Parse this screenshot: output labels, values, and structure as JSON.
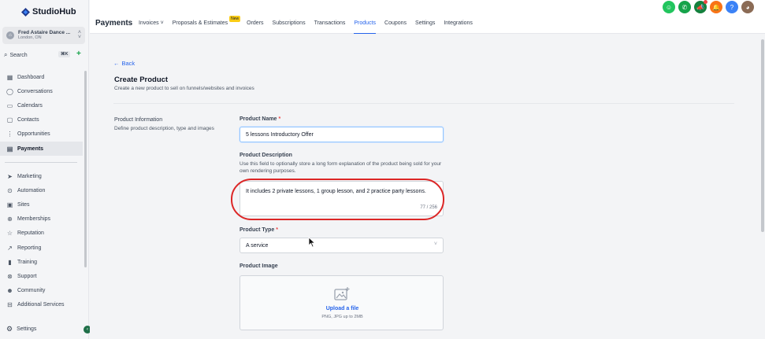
{
  "app": {
    "logo": "StudioHub",
    "account": {
      "name": "Fred Astaire Dance ...",
      "location": "London, ON"
    },
    "search": {
      "label": "Search",
      "shortcut": "⌘K"
    }
  },
  "sidebar": {
    "items": [
      {
        "label": "Dashboard",
        "icon": "dashboard-icon"
      },
      {
        "label": "Conversations",
        "icon": "chat-icon"
      },
      {
        "label": "Calendars",
        "icon": "calendar-icon"
      },
      {
        "label": "Contacts",
        "icon": "contacts-icon"
      },
      {
        "label": "Opportunities",
        "icon": "opportunities-icon"
      },
      {
        "label": "Payments",
        "icon": "payments-icon",
        "active": true
      }
    ],
    "items2": [
      {
        "label": "Marketing",
        "icon": "send-icon"
      },
      {
        "label": "Automation",
        "icon": "automation-icon"
      },
      {
        "label": "Sites",
        "icon": "sites-icon"
      },
      {
        "label": "Memberships",
        "icon": "memberships-icon"
      },
      {
        "label": "Reputation",
        "icon": "star-icon"
      },
      {
        "label": "Reporting",
        "icon": "reporting-icon"
      },
      {
        "label": "Training",
        "icon": "book-icon"
      },
      {
        "label": "Support",
        "icon": "support-icon"
      },
      {
        "label": "Community",
        "icon": "community-icon"
      },
      {
        "label": "Additional Services",
        "icon": "cart-icon"
      }
    ],
    "settings": "Settings"
  },
  "header": {
    "title": "Payments",
    "tabs": [
      {
        "label": "Invoices ˅"
      },
      {
        "label": "Proposals & Estimates",
        "badge": "New"
      },
      {
        "label": "Orders"
      },
      {
        "label": "Subscriptions"
      },
      {
        "label": "Transactions"
      },
      {
        "label": "Products",
        "active": true
      },
      {
        "label": "Coupons"
      },
      {
        "label": "Settings"
      },
      {
        "label": "Integrations"
      }
    ]
  },
  "form": {
    "back": "Back",
    "title": "Create Product",
    "subtitle": "Create a new product to sell on funnels/websites and invoices",
    "section_title": "Product Information",
    "section_desc": "Define product description, type and images",
    "name_label": "Product Name",
    "name_value": "5 lessons Introductory Offer",
    "desc_label": "Product Description",
    "desc_help": "Use this field to optionally store a long form explanation of the product being sold for your own rendering purposes.",
    "desc_value": "It includes 2 private lessons, 1 group lesson, and 2 practice party lessons.",
    "desc_counter": "77 / 256",
    "type_label": "Product Type",
    "type_value": "A service",
    "image_label": "Product Image",
    "upload_link": "Upload a file",
    "upload_hint": "PNG, JPG up to 2MB"
  },
  "colors": {
    "accent": "#2563eb",
    "highlight": "#dc2626"
  }
}
